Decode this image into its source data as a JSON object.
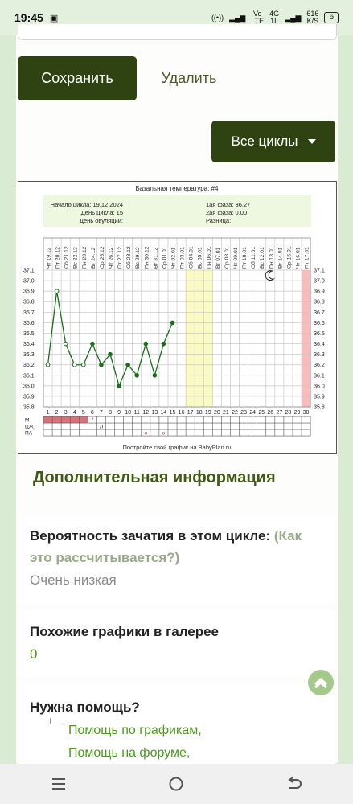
{
  "status": {
    "time": "19:45",
    "network_top": "Vo",
    "network_bottom": "LTE",
    "signal_top": "4G",
    "signal_bottom": "1L",
    "speed_top": "616",
    "speed_bottom": "K/S",
    "battery": "6"
  },
  "actions": {
    "save_label": "Сохранить",
    "delete_label": "Удалить",
    "all_cycles_label": "Все циклы"
  },
  "chart_data": {
    "type": "line",
    "title": "Базальная температура: #4",
    "info": {
      "cycle_start_label": "Начало цикла:",
      "cycle_start_value": "19.12.2024",
      "cycle_day_label": "День цикла:",
      "cycle_day_value": "15",
      "ovulation_day_label": "День овуляции:",
      "ovulation_day_value": "",
      "phase1_label": "1ая фаза:",
      "phase1_value": "36.27",
      "phase2_label": "2ая фаза:",
      "phase2_value": "0.00",
      "difference_label": "Разница:",
      "difference_value": ""
    },
    "dates": [
      "Чт 19.12",
      "Пт 20.12",
      "Сб 21.12",
      "Вс 22.12",
      "Пн 23.12",
      "Вт 24.12",
      "Ср 25.12",
      "Чт 26.12",
      "Пт 27.12",
      "Сб 28.12",
      "Вс 29.12",
      "Пн 30.12",
      "Вт 31.12",
      "Ср 01.01",
      "Чт 02.01",
      "Пт 03.01",
      "Сб 04.01",
      "Вс 05.01",
      "Пн 06.01",
      "Вт 07.01",
      "Ср 08.01",
      "Чт 09.01",
      "Пт 10.01",
      "Сб 11.01",
      "Вс 12.01",
      "Пн 13.01",
      "Вт 14.01",
      "Ср 15.01",
      "Чт 16.01",
      "Пт 17.01"
    ],
    "days": [
      "1",
      "2",
      "3",
      "4",
      "5",
      "6",
      "7",
      "8",
      "9",
      "10",
      "11",
      "12",
      "13",
      "14",
      "15",
      "16",
      "17",
      "18",
      "19",
      "20",
      "21",
      "22",
      "23",
      "24",
      "25",
      "26",
      "27",
      "28",
      "29",
      "30"
    ],
    "y_ticks": [
      "37.1",
      "37.0",
      "36.9",
      "36.8",
      "36.7",
      "36.6",
      "36.5",
      "36.4",
      "36.3",
      "36.2",
      "36.1",
      "36.0",
      "35.9",
      "35.8"
    ],
    "ylim": [
      35.8,
      37.1
    ],
    "values": [
      36.2,
      36.9,
      36.4,
      36.2,
      36.2,
      36.4,
      36.2,
      36.3,
      36.0,
      36.2,
      36.1,
      36.4,
      36.1,
      36.4,
      36.6
    ],
    "open_point_days": [
      1,
      2,
      3,
      4,
      5
    ],
    "yellow_highlight_days": [
      17,
      18,
      19
    ],
    "pink_highlight_days": [
      30
    ],
    "moon_day": 26,
    "row_labels": [
      "М",
      "ЦЖ",
      "ПА"
    ],
    "menstruation_days": [
      1,
      2,
      3,
      4,
      5
    ],
    "m_star_day": 6,
    "m_star": "*",
    "czh_mark_day": 7,
    "czh_mark": "Л",
    "pa_mark_days": [
      12,
      14
    ],
    "pa_mark": "o",
    "footer": "Постройте свой график на BabyPlan.ru",
    "colors": {
      "line": "#1b6e1b",
      "menstruation": "#d9737b",
      "yellow": "#fafac3",
      "pink": "#f8bcbc",
      "info_bg": "#eef7e0"
    }
  },
  "info": {
    "section_title": "Дополнительная информация",
    "probability_label": "Вероятность зачатия в этом цикле:",
    "probability_hint": "(Как это рассчитывается?)",
    "probability_value": "Очень низкая",
    "gallery_label": "Похожие графики в галерее",
    "gallery_value": "0",
    "help_label": "Нужна помощь?",
    "help_link_charts": "Помощь по графикам,",
    "help_link_forum": "Помощь на форуме,"
  },
  "icons": {
    "scroll_top": "chevron-up-icon",
    "nav_menu": "menu-icon",
    "nav_home": "home-circle-icon",
    "nav_back": "back-icon",
    "moon": "moon-icon"
  }
}
